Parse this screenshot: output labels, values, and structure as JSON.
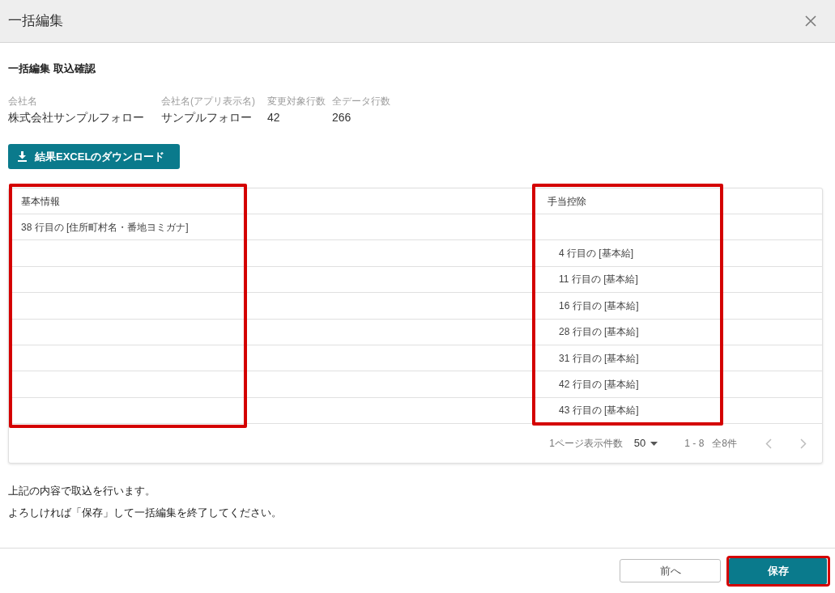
{
  "dialog": {
    "title": "一括編集"
  },
  "section_title": "一括編集 取込確認",
  "summary": [
    {
      "label": "会社名",
      "value": "株式会社サンプルフォロー"
    },
    {
      "label": "会社名(アプリ表示名)",
      "value": "サンプルフォロー"
    },
    {
      "label": "変更対象行数",
      "value": "42"
    },
    {
      "label": "全データ行数",
      "value": "266"
    }
  ],
  "download_button": {
    "label": "結果EXCELのダウンロード"
  },
  "table": {
    "columns": [
      {
        "label": "基本情報",
        "highlighted": true
      },
      {
        "label": "手当控除",
        "highlighted": true
      }
    ],
    "rows": [
      [
        "38 行目の [住所町村名・番地ヨミガナ]",
        null
      ],
      [
        null,
        "4 行目の [基本給]"
      ],
      [
        null,
        "11 行目の [基本給]"
      ],
      [
        null,
        "16 行目の [基本給]"
      ],
      [
        null,
        "28 行目の [基本給]"
      ],
      [
        null,
        "31 行目の [基本給]"
      ],
      [
        null,
        "42 行目の [基本給]"
      ],
      [
        null,
        "43 行目の [基本給]"
      ]
    ],
    "pagination": {
      "rows_per_page_label": "1ページ表示件数",
      "rows_per_page": "50",
      "range": "1 - 8",
      "total": "全8件",
      "prev": {
        "disabled": true
      },
      "next": {
        "disabled": true
      }
    }
  },
  "message": [
    "上記の内容で取込を行います。",
    "よろしければ「保存」して一括編集を終了してください。"
  ],
  "buttons": [
    {
      "kind": "secondary",
      "label": "前へ",
      "highlighted": false
    },
    {
      "kind": "primary",
      "label": "保存",
      "highlighted": true
    }
  ]
}
